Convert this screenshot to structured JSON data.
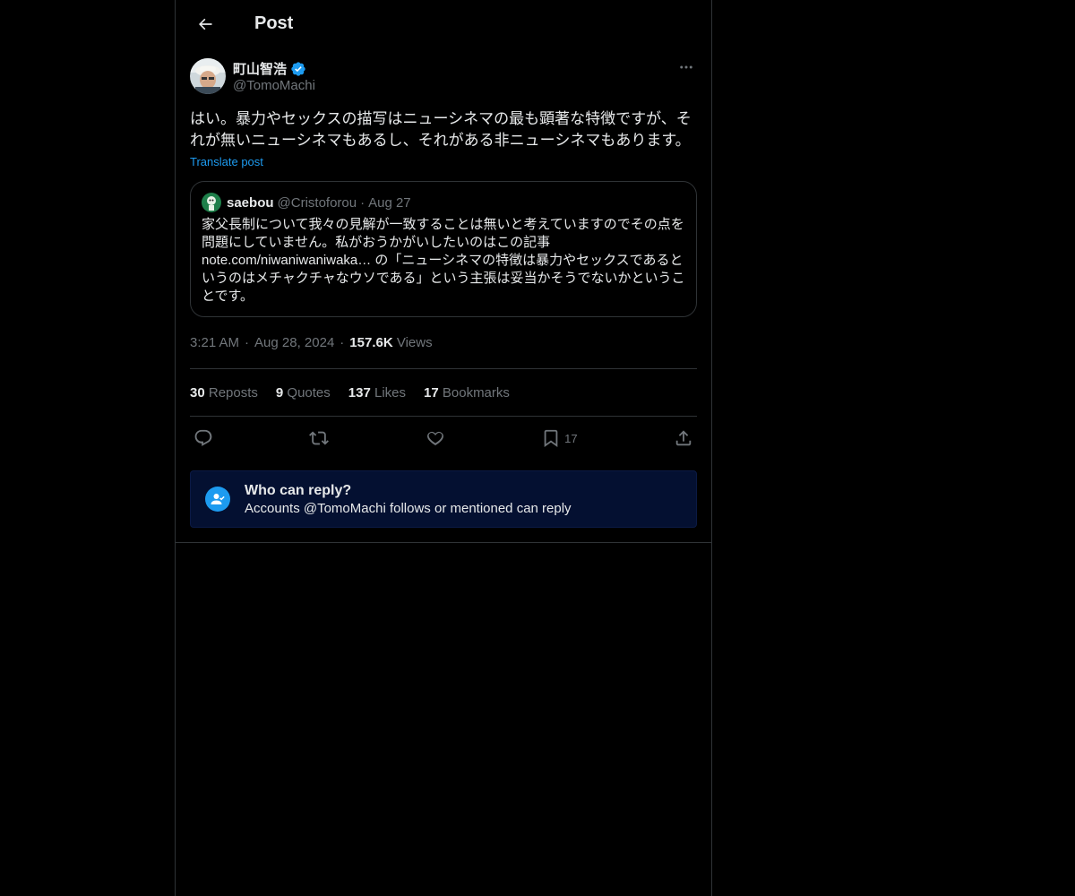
{
  "header": {
    "title": "Post"
  },
  "author": {
    "name": "町山智浩",
    "handle": "@TomoMachi",
    "verified": true
  },
  "post": {
    "text": "はい。暴力やセックスの描写はニューシネマの最も顕著な特徴ですが、それが無いニューシネマもあるし、それがある非ニューシネマもあります。",
    "translate_label": "Translate post"
  },
  "quote": {
    "name": "saebou",
    "handle": "@Cristoforou",
    "sep": "·",
    "date": "Aug 27",
    "text": "家父長制について我々の見解が一致することは無いと考えていますのでその点を問題にしていません。私がおうかがいしたいのはこの記事 note.com/niwaniwaniwaka… の「ニューシネマの特徴は暴力やセックスであるというのはメチャクチャなウソである」という主張は妥当かそうでないかということです。"
  },
  "meta": {
    "time": "3:21 AM",
    "sep": "·",
    "date": "Aug 28, 2024",
    "views_count": "157.6K",
    "views_label": "Views"
  },
  "stats": {
    "reposts": {
      "count": "30",
      "label": "Reposts"
    },
    "quotes": {
      "count": "9",
      "label": "Quotes"
    },
    "likes": {
      "count": "137",
      "label": "Likes"
    },
    "bookmarks": {
      "count": "17",
      "label": "Bookmarks"
    }
  },
  "actions": {
    "bookmark_count": "17"
  },
  "reply_restriction": {
    "title": "Who can reply?",
    "subtitle": "Accounts @TomoMachi follows or mentioned can reply"
  },
  "colors": {
    "background": "#000000",
    "accent": "#1d9bf0",
    "muted": "#71767b",
    "reply_box": "#041031"
  },
  "icons": [
    "back-arrow-icon",
    "verified-badge-icon",
    "more-icon",
    "reply-icon",
    "repost-icon",
    "like-icon",
    "bookmark-icon",
    "share-icon",
    "person-check-icon"
  ]
}
